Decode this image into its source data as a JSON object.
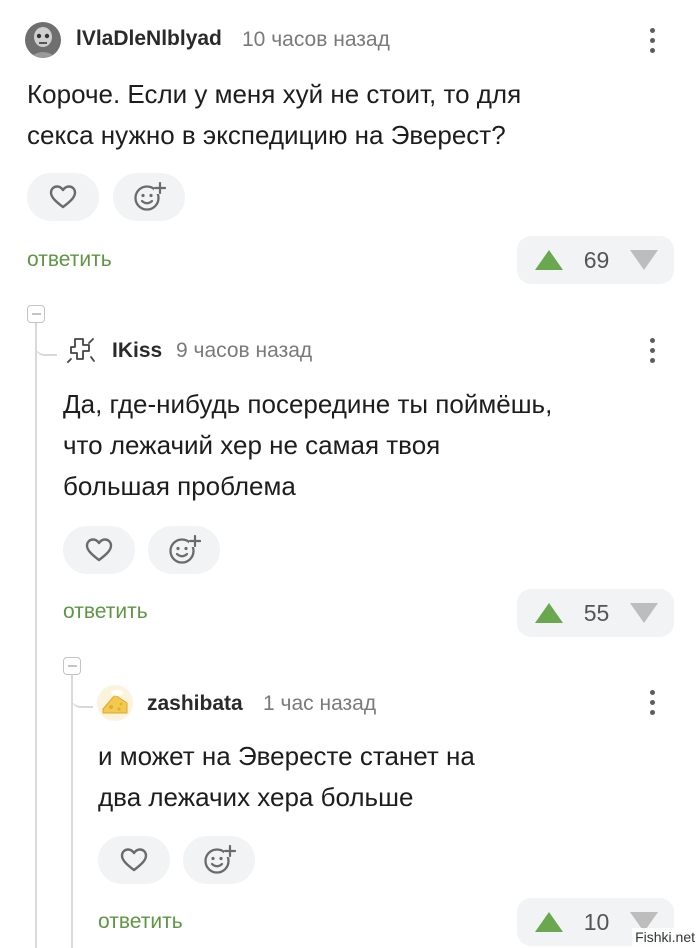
{
  "colors": {
    "accent_green": "#5e9643",
    "vote_up": "#6aa84f",
    "vote_down": "#bdbdbd",
    "button_bg": "#f1f3f4"
  },
  "comments": [
    {
      "username": "lVlaDleNlblyad",
      "time": "10 часов назад",
      "lines": [
        "Короче. Если у меня хуй не стоит, то для",
        "секса нужно в экспедицию на Эверест?"
      ],
      "reply_label": "ответить",
      "rating": "69",
      "avatar_icon": "photo-avatar"
    },
    {
      "username": "IKiss",
      "time": "9 часов назад",
      "lines": [
        "Да, где-нибудь посередине ты поймёшь,",
        "что лежачий хер не самая твоя",
        "большая проблема"
      ],
      "reply_label": "ответить",
      "rating": "55",
      "avatar_icon": "outline-glyph-avatar"
    },
    {
      "username": "zashibata",
      "time": "1 час назад",
      "lines": [
        "и может на Эвересте станет на",
        "два лежачих хера больше"
      ],
      "reply_label": "ответить",
      "rating": "10",
      "avatar_icon": "cheese-avatar"
    }
  ],
  "watermark": "Fishki.net"
}
